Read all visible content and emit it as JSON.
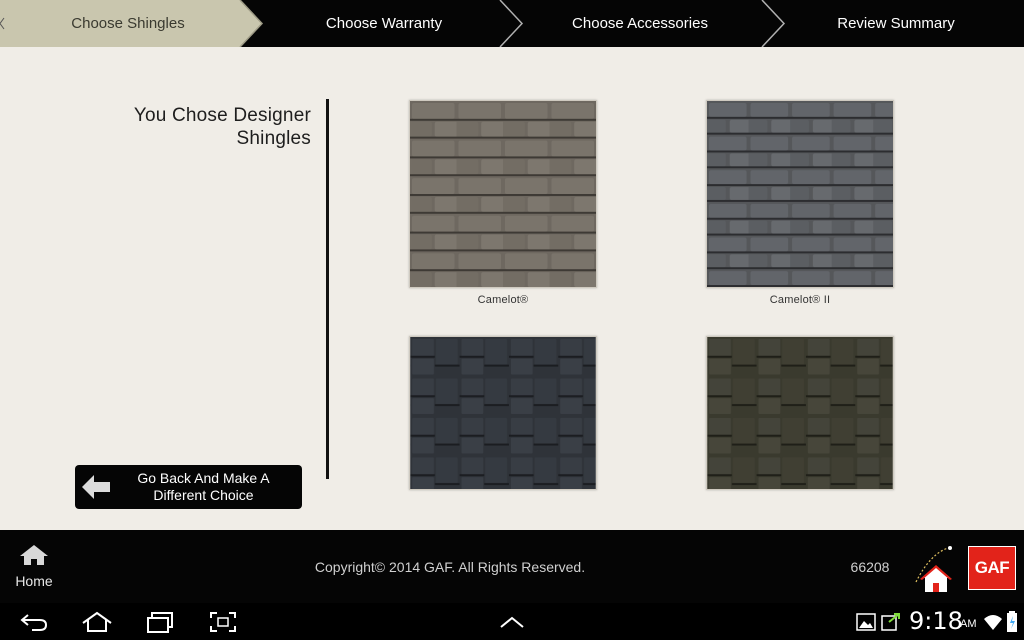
{
  "steps": [
    {
      "label": "Choose Shingles",
      "active": true
    },
    {
      "label": "Choose Warranty",
      "active": false
    },
    {
      "label": "Choose Accessories",
      "active": false
    },
    {
      "label": "Review Summary",
      "active": false
    }
  ],
  "main": {
    "chosen_title": "You Chose Designer Shingles",
    "back_button_label": "Go Back And Make A Different Choice",
    "shingles": [
      {
        "name": "Camelot®"
      },
      {
        "name": "Camelot® II"
      },
      {
        "name": ""
      },
      {
        "name": ""
      }
    ]
  },
  "footer": {
    "home_label": "Home",
    "copyright": "Copyright© 2014 GAF. All Rights Reserved.",
    "code": "66208",
    "brand_logo_text": "GAF"
  },
  "system_bar": {
    "time": "9:18",
    "ampm": "AM"
  },
  "colors": {
    "active_step": "#c9c6ae",
    "bar_background": "#050505",
    "content_background": "#f0ede7",
    "brand_red": "#e2231a"
  },
  "icons": [
    "back-arrow-icon",
    "home-icon",
    "house-logo-icon",
    "android-back-icon",
    "android-home-icon",
    "android-recent-apps-icon",
    "screenshot-icon",
    "chevron-up-icon",
    "gallery-icon",
    "usb-icon",
    "wifi-icon",
    "battery-icon"
  ]
}
